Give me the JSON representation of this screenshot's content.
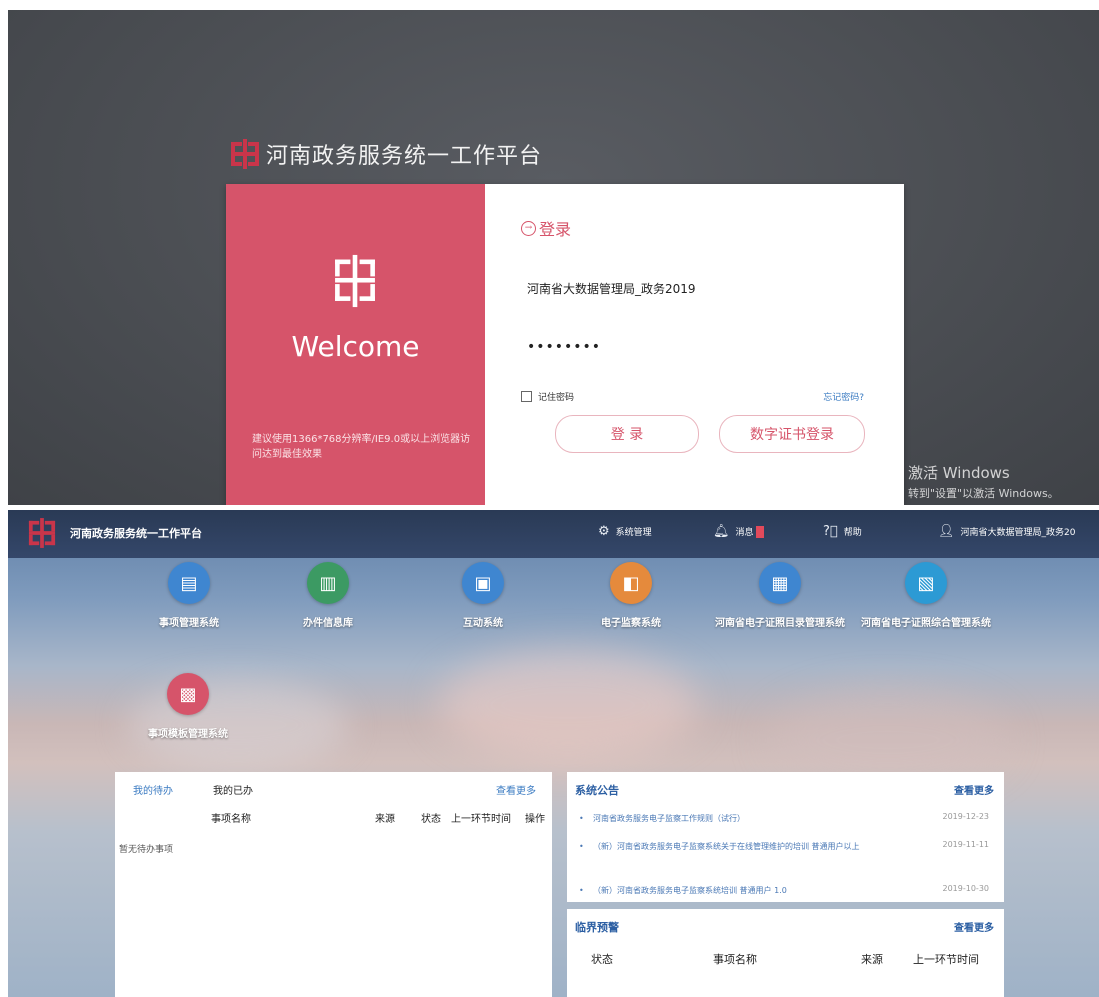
{
  "login": {
    "platform_title": "河南政务服务统一工作平台",
    "welcome": "Welcome",
    "resolution_tip": "建议使用1366*768分辨率/IE9.0或以上浏览器访问达到最佳效果",
    "form_title": "登录",
    "username_value": "河南省大数据管理局_政务2019",
    "password_value": "••••••••",
    "remember_label": "记住密码",
    "forgot_label": "忘记密码?",
    "login_button": "登 录",
    "cert_button": "数字证书登录"
  },
  "activation": {
    "line1": "激活 Windows",
    "line2": "转到\"设置\"以激活 Windows。"
  },
  "dashboard": {
    "brand": "河南政务服务统一工作平台",
    "topbar": {
      "settings": "系统管理",
      "messages": "消息",
      "help": "帮助",
      "user": "河南省大数据管理局_政务20"
    },
    "apps": [
      {
        "label": "事项管理系统",
        "icon": "document-icon",
        "color": "#3f86d0"
      },
      {
        "label": "办件信息库",
        "icon": "printer-icon",
        "color": "#3c9a63"
      },
      {
        "label": "互动系统",
        "icon": "id-card-icon",
        "color": "#3f86d0"
      },
      {
        "label": "电子监察系统",
        "icon": "camera-icon",
        "color": "#e58a3c"
      },
      {
        "label": "河南省电子证照目录管理系统",
        "icon": "certificate-icon",
        "color": "#3f86d0"
      },
      {
        "label": "河南省电子证照综合管理系统",
        "icon": "contact-card-icon",
        "color": "#2c9ad4"
      },
      {
        "label": "事项模板管理系统",
        "icon": "template-icon",
        "color": "#d6546a"
      }
    ],
    "todo": {
      "tab_todo": "我的待办",
      "tab_done": "我的已办",
      "more": "查看更多",
      "columns": [
        "事项名称",
        "来源",
        "状态",
        "上一环节时间",
        "操作"
      ],
      "empty": "暂无待办事项"
    },
    "notices": {
      "title": "系统公告",
      "more": "查看更多",
      "items": [
        {
          "text": "河南省政务服务电子监察工作规则（试行）",
          "date": "2019-12-23"
        },
        {
          "text": "（新）河南省政务服务电子监察系统关于在线管理维护的培训 普通用户以上",
          "date": "2019-11-11"
        },
        {
          "text": "（新）河南省政务服务电子监察系统培训 普通用户 1.0",
          "date": "2019-10-30"
        }
      ]
    },
    "warnings": {
      "title": "临界预警",
      "more": "查看更多",
      "columns": [
        "状态",
        "事项名称",
        "来源",
        "上一环节时间"
      ]
    }
  }
}
